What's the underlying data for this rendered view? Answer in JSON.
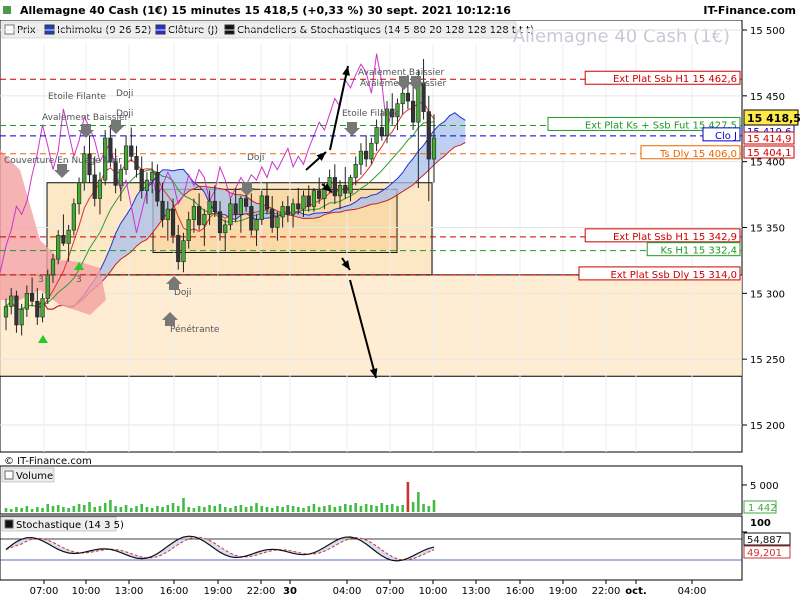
{
  "header": {
    "title": "Allemagne 40 Cash (1€) 15 minutes 15 418,5 (+0,33 %) 30 sept. 2021 10:12:16",
    "site": "IT-Finance.com",
    "watermark": "Allemagne 40 Cash (1€)"
  },
  "legend": [
    {
      "label": "Prix",
      "color": "#ffffff",
      "icon": "price-swatch-icon"
    },
    {
      "label": "Ichimoku (9 26 52)",
      "color": "#1f3fbf",
      "icon": "ichimoku-swatch-icon"
    },
    {
      "label": "Clôture (J)",
      "color": "#2233dd",
      "icon": "close-daily-swatch-icon"
    },
    {
      "label": "Chandeliers & Stochastiques (14 5 80 20 128 128 128 t t t)",
      "color": "#111111",
      "icon": "candles-swatch-icon"
    }
  ],
  "copyright": "© IT-Finance.com",
  "chart_data": [
    {
      "type": "candlestick",
      "title": "Allemagne 40 Cash (1€) 15 minutes",
      "ylim": [
        15190,
        15500
      ],
      "y_ticks": [
        15200,
        15250,
        15300,
        15350,
        15400,
        15450,
        15500
      ],
      "y_tick_labels": [
        "15 200",
        "15 250",
        "15 300",
        "15 350",
        "15 400",
        "15 450",
        "15 500"
      ],
      "x_tick_labels": [
        "07:00",
        "10:00",
        "13:00",
        "16:00",
        "19:00",
        "22:00",
        "30",
        "04:00",
        "07:00",
        "10:00",
        "13:00",
        "16:00",
        "19:00",
        "22:00",
        "oct.",
        "04:00"
      ],
      "last_price": {
        "label": "15 418,5",
        "value": 15418.5
      },
      "price_labels": [
        {
          "label": "15 419,6",
          "value": 15419.6
        },
        {
          "label": "15 414,9",
          "value": 15414.9
        },
        {
          "label": "15 404,1",
          "value": 15404.1
        }
      ],
      "levels": [
        {
          "label": "Ext Plat Ssb H1 15 462,6",
          "value": 15462.6,
          "color": "#cc0000"
        },
        {
          "label": "Ext Plat Ks + Ssb Fut 15 427,5",
          "value": 15427.5,
          "color": "#229922"
        },
        {
          "label": "Clo J",
          "value": 15419.6,
          "color": "#0000cc"
        },
        {
          "label": "Ts Dly 15 406,0",
          "value": 15406.0,
          "color": "#ee6600"
        },
        {
          "label": "Ext Plat Ssb H1 15 342,9",
          "value": 15342.9,
          "color": "#cc0000"
        },
        {
          "label": "Ks H1 15 332,4",
          "value": 15332.4,
          "color": "#229922"
        },
        {
          "label": "Ext Plat Ssb Dly 15 314,0",
          "value": 15314.0,
          "color": "#cc0000"
        }
      ],
      "annotations": [
        {
          "label": "Etoile Filante",
          "kind": "down"
        },
        {
          "label": "Avalement Baissier",
          "kind": "down"
        },
        {
          "label": "Doji",
          "kind": "down"
        },
        {
          "label": "Doji",
          "kind": "down"
        },
        {
          "label": "Couverture En Nuage Noir",
          "kind": "down"
        },
        {
          "label": "Doji",
          "kind": "down"
        },
        {
          "label": "Doji",
          "kind": "up"
        },
        {
          "label": "Pénétrante",
          "kind": "up"
        },
        {
          "label": "Etoile Filante",
          "kind": "down"
        },
        {
          "label": "Avalement Baissier",
          "kind": "down"
        },
        {
          "label": "Avalement Baissier",
          "kind": "down"
        },
        {
          "label": "3",
          "kind": "count"
        },
        {
          "label": "3",
          "kind": "count"
        }
      ],
      "candles_ohlc": [
        [
          15282,
          15296,
          15272,
          15290
        ],
        [
          15290,
          15304,
          15284,
          15298
        ],
        [
          15298,
          15302,
          15270,
          15276
        ],
        [
          15276,
          15292,
          15268,
          15288
        ],
        [
          15288,
          15306,
          15282,
          15300
        ],
        [
          15300,
          15312,
          15290,
          15294
        ],
        [
          15294,
          15304,
          15276,
          15282
        ],
        [
          15282,
          15300,
          15278,
          15296
        ],
        [
          15296,
          15318,
          15292,
          15314
        ],
        [
          15314,
          15330,
          15308,
          15326
        ],
        [
          15326,
          15348,
          15322,
          15344
        ],
        [
          15344,
          15360,
          15336,
          15338
        ],
        [
          15338,
          15352,
          15324,
          15348
        ],
        [
          15348,
          15372,
          15344,
          15368
        ],
        [
          15368,
          15388,
          15360,
          15384
        ],
        [
          15384,
          15412,
          15378,
          15406
        ],
        [
          15406,
          15420,
          15384,
          15390
        ],
        [
          15390,
          15404,
          15366,
          15372
        ],
        [
          15372,
          15392,
          15360,
          15386
        ],
        [
          15386,
          15424,
          15382,
          15418
        ],
        [
          15418,
          15428,
          15396,
          15400
        ],
        [
          15400,
          15410,
          15376,
          15382
        ],
        [
          15382,
          15398,
          15370,
          15394
        ],
        [
          15394,
          15420,
          15390,
          15412
        ],
        [
          15412,
          15426,
          15400,
          15404
        ],
        [
          15404,
          15412,
          15388,
          15394
        ],
        [
          15394,
          15404,
          15372,
          15378
        ],
        [
          15378,
          15392,
          15368,
          15386
        ],
        [
          15386,
          15400,
          15376,
          15392
        ],
        [
          15392,
          15398,
          15366,
          15370
        ],
        [
          15370,
          15384,
          15350,
          15356
        ],
        [
          15356,
          15370,
          15340,
          15364
        ],
        [
          15364,
          15372,
          15338,
          15344
        ],
        [
          15344,
          15352,
          15318,
          15324
        ],
        [
          15324,
          15346,
          15316,
          15340
        ],
        [
          15340,
          15362,
          15334,
          15356
        ],
        [
          15356,
          15372,
          15346,
          15366
        ],
        [
          15366,
          15376,
          15348,
          15352
        ],
        [
          15352,
          15364,
          15336,
          15360
        ],
        [
          15360,
          15378,
          15352,
          15370
        ],
        [
          15370,
          15382,
          15358,
          15362
        ],
        [
          15362,
          15370,
          15340,
          15346
        ],
        [
          15346,
          15356,
          15332,
          15352
        ],
        [
          15352,
          15372,
          15348,
          15368
        ],
        [
          15368,
          15380,
          15354,
          15360
        ],
        [
          15360,
          15374,
          15346,
          15372
        ],
        [
          15372,
          15384,
          15362,
          15366
        ],
        [
          15366,
          15376,
          15344,
          15348
        ],
        [
          15348,
          15360,
          15336,
          15356
        ],
        [
          15356,
          15378,
          15352,
          15374
        ],
        [
          15374,
          15384,
          15360,
          15364
        ],
        [
          15364,
          15374,
          15346,
          15350
        ],
        [
          15350,
          15362,
          15340,
          15358
        ],
        [
          15358,
          15370,
          15350,
          15366
        ],
        [
          15366,
          15374,
          15354,
          15360
        ],
        [
          15360,
          15372,
          15350,
          15368
        ],
        [
          15368,
          15380,
          15360,
          15364
        ],
        [
          15364,
          15378,
          15358,
          15374
        ],
        [
          15374,
          15382,
          15362,
          15366
        ],
        [
          15366,
          15380,
          15362,
          15378
        ],
        [
          15378,
          15388,
          15368,
          15372
        ],
        [
          15372,
          15384,
          15364,
          15380
        ],
        [
          15380,
          15394,
          15376,
          15388
        ],
        [
          15388,
          15398,
          15368,
          15374
        ],
        [
          15374,
          15386,
          15364,
          15382
        ],
        [
          15382,
          15396,
          15372,
          15376
        ],
        [
          15376,
          15390,
          15370,
          15388
        ],
        [
          15388,
          15404,
          15382,
          15398
        ],
        [
          15398,
          15414,
          15390,
          15408
        ],
        [
          15408,
          15420,
          15396,
          15402
        ],
        [
          15402,
          15418,
          15398,
          15414
        ],
        [
          15414,
          15432,
          15408,
          15426
        ],
        [
          15426,
          15440,
          15416,
          15420
        ],
        [
          15420,
          15446,
          15414,
          15440
        ],
        [
          15440,
          15452,
          15428,
          15434
        ],
        [
          15434,
          15448,
          15424,
          15444
        ],
        [
          15444,
          15462,
          15436,
          15452
        ],
        [
          15452,
          15466,
          15440,
          15446
        ],
        [
          15446,
          15458,
          15424,
          15430
        ],
        [
          15430,
          15470,
          15380,
          15460
        ],
        [
          15460,
          15478,
          15432,
          15438
        ],
        [
          15438,
          15450,
          15370,
          15402
        ],
        [
          15402,
          15436,
          15384,
          15418
        ]
      ]
    },
    {
      "type": "bar",
      "title": "Volume",
      "y_tick_labels": [
        "5 000"
      ],
      "last_value": {
        "label": "1 442",
        "value": 1442
      }
    },
    {
      "type": "line",
      "title": "Stochastique (14 3 5)",
      "ylim": [
        0,
        100
      ],
      "y_tick_labels": [
        "100"
      ],
      "series": [
        {
          "label": "54,887",
          "value": 54.887,
          "color": "#111111"
        },
        {
          "label": "49,201",
          "value": 49.201,
          "color": "#cc3333"
        }
      ]
    }
  ]
}
